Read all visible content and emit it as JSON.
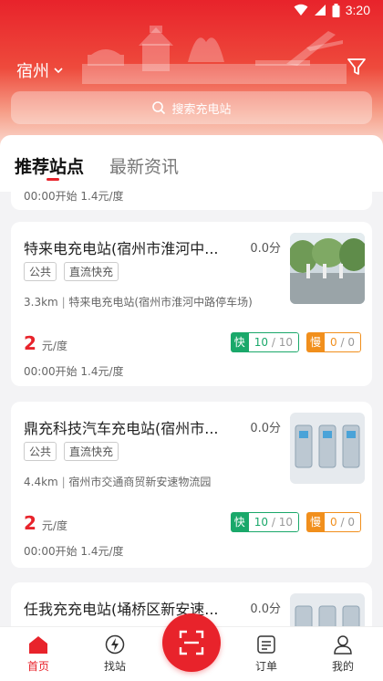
{
  "status": {
    "time": "3:20"
  },
  "header": {
    "city": "宿州",
    "search_placeholder": "搜索充电站"
  },
  "tabs": [
    {
      "label": "推荐站点",
      "active": true
    },
    {
      "label": "最新资讯",
      "active": false
    }
  ],
  "partial_card": {
    "time_line": "00:00开始 1.4元/度"
  },
  "stations": [
    {
      "name": "特来电充电站(宿州市淮河中...",
      "distance_top": "0.0分",
      "tags": [
        "公共",
        "直流快充"
      ],
      "distance": "3.3km",
      "address": "特来电充电站(宿州市淮河中路停车场)",
      "price": "2",
      "price_unit": "元/度",
      "time_line": "00:00开始 1.4元/度",
      "fast": {
        "label": "快",
        "free": "10",
        "total": "/ 10"
      },
      "slow": {
        "label": "慢",
        "free": "0",
        "total": "/ 0"
      }
    },
    {
      "name": "鼎充科技汽车充电站(宿州市...",
      "distance_top": "0.0分",
      "tags": [
        "公共",
        "直流快充"
      ],
      "distance": "4.4km",
      "address": "宿州市交通商贸新安速物流园",
      "price": "2",
      "price_unit": "元/度",
      "time_line": "00:00开始 1.4元/度",
      "fast": {
        "label": "快",
        "free": "10",
        "total": "/ 10"
      },
      "slow": {
        "label": "慢",
        "free": "0",
        "total": "/ 0"
      }
    },
    {
      "name": "任我充充电站(埇桥区新安速...",
      "distance_top": "0.0分"
    }
  ],
  "tabbar": {
    "items": [
      {
        "label": "首页",
        "active": true
      },
      {
        "label": "找站",
        "active": false
      },
      {
        "label": "订单",
        "active": false
      },
      {
        "label": "我的",
        "active": false
      }
    ]
  },
  "colors": {
    "brand": "#e8232b",
    "fast": "#1aa86a",
    "slow": "#f18f1c"
  }
}
